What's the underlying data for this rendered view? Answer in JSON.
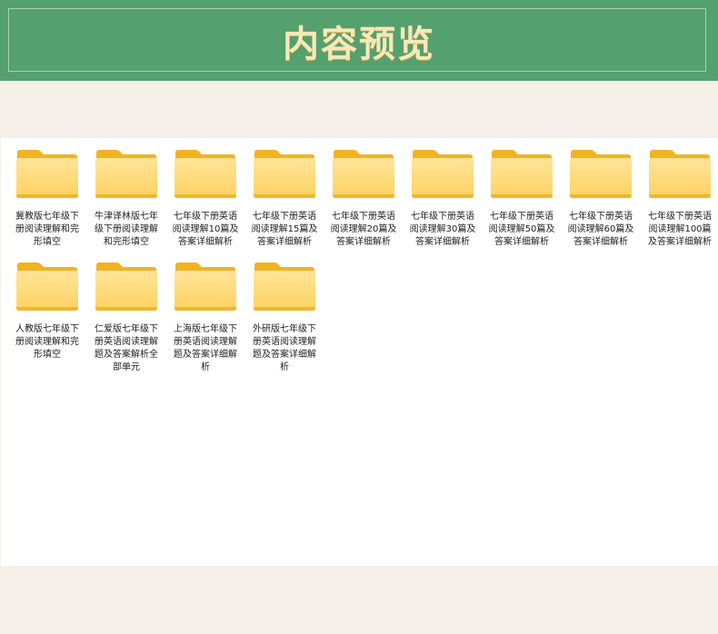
{
  "header": {
    "title": "内容预览"
  },
  "folders": [
    {
      "name": "冀教版七年级下册阅读理解和完形填空"
    },
    {
      "name": "牛津译林版七年级下册阅读理解和完形填空"
    },
    {
      "name": "七年级下册英语阅读理解10篇及答案详细解析"
    },
    {
      "name": "七年级下册英语阅读理解15篇及答案详细解析"
    },
    {
      "name": "七年级下册英语阅读理解20篇及答案详细解析"
    },
    {
      "name": "七年级下册英语阅读理解30篇及答案详细解析"
    },
    {
      "name": "七年级下册英语阅读理解50篇及答案详细解析"
    },
    {
      "name": "七年级下册英语阅读理解60篇及答案详细解析"
    },
    {
      "name": "七年级下册英语阅读理解100篇及答案详细解析"
    },
    {
      "name": "人教版七年级下册阅读理解和完形填空"
    },
    {
      "name": "仁爱版七年级下册英语阅读理解题及答案解析全部单元"
    },
    {
      "name": "上海版七年级下册英语阅读理解题及答案详细解析"
    },
    {
      "name": "外研版七年级下册英语阅读理解题及答案详细解析"
    }
  ],
  "colors": {
    "header_bg": "#55a06f",
    "title_color": "#f6e9b8",
    "folder_back": "#f3b424",
    "folder_front": "#ffd76a"
  }
}
